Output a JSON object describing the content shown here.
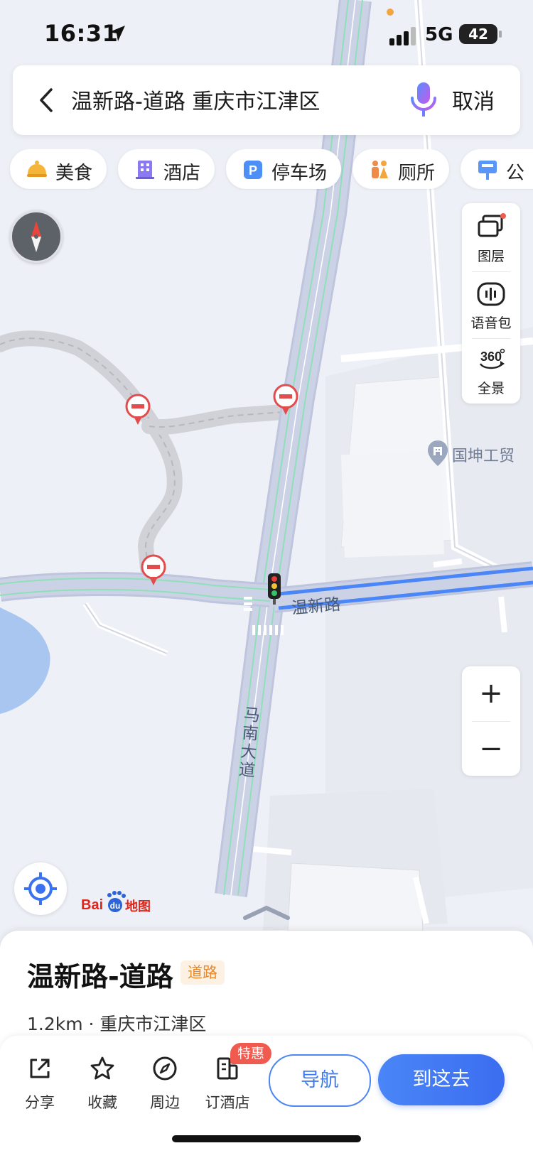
{
  "status_bar": {
    "time": "16:31",
    "network": "5G",
    "battery": "42"
  },
  "search": {
    "query": "温新路-道路 重庆市江津区",
    "cancel_label": "取消"
  },
  "categories": [
    {
      "label": "美食",
      "icon": "food-icon"
    },
    {
      "label": "酒店",
      "icon": "hotel-icon"
    },
    {
      "label": "停车场",
      "icon": "parking-icon"
    },
    {
      "label": "厕所",
      "icon": "toilet-icon"
    },
    {
      "label": "公",
      "icon": "bus-stop-icon"
    }
  ],
  "map_tools": [
    {
      "label": "图层",
      "icon": "layers-icon"
    },
    {
      "label": "语音包",
      "icon": "voice-pack-icon"
    },
    {
      "label": "全景",
      "icon": "panorama-360-icon"
    }
  ],
  "map_labels": {
    "road_horizontal": "温新路",
    "road_vertical": "马南大道",
    "poi": "国坤工贸",
    "logo": "Baidu地图"
  },
  "zoom": {
    "in_label": "+",
    "out_label": "−"
  },
  "place": {
    "title": "温新路-道路",
    "tag": "道路",
    "subtitle": "1.2km · 重庆市江津区"
  },
  "actions": [
    {
      "label": "分享",
      "icon": "share-icon"
    },
    {
      "label": "收藏",
      "icon": "star-icon"
    },
    {
      "label": "周边",
      "icon": "compass-nearby-icon"
    },
    {
      "label": "订酒店",
      "icon": "hotel-booking-icon"
    }
  ],
  "promo_badge": "特惠",
  "nav_label": "导航",
  "go_label": "到这去",
  "colors": {
    "accent": "#3b6df0",
    "road_blue": "#4a86f7",
    "promo": "#f05a4f",
    "tag_text": "#e8892c"
  }
}
